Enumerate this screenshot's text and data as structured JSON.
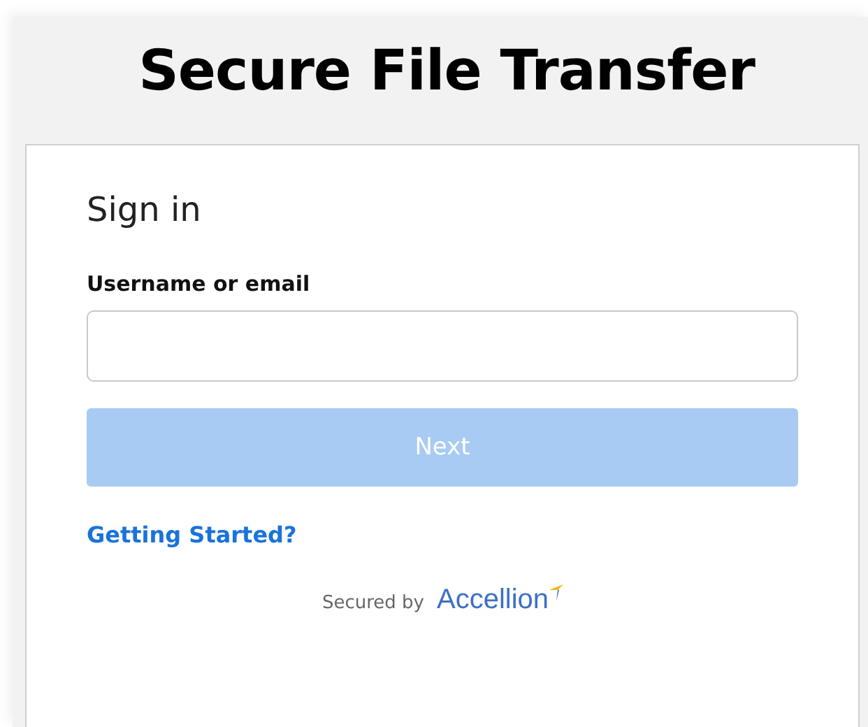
{
  "header": {
    "title": "Secure File Transfer"
  },
  "form": {
    "heading": "Sign in",
    "field_label": "Username or email",
    "button": {
      "label": "Next",
      "disabled": true
    },
    "link": "Getting Started?"
  },
  "footer": {
    "secured_by": "Secured by",
    "brand": "Accellion"
  }
}
